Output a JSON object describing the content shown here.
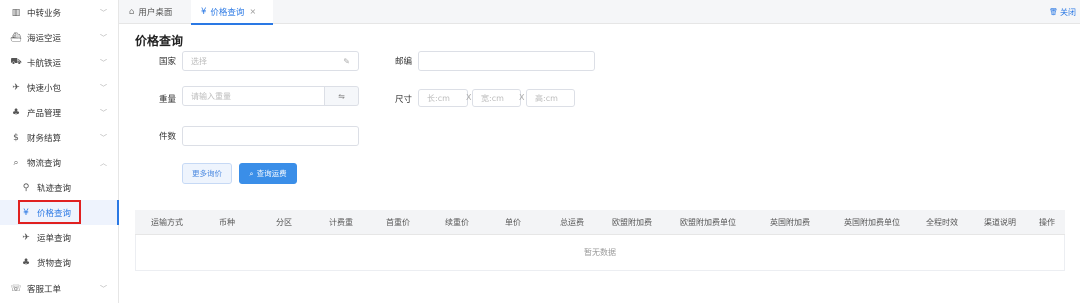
{
  "sidebar": {
    "items": [
      {
        "icon": "chart-icon",
        "glyph": "▥",
        "label": "中转业务",
        "chev": "﹀"
      },
      {
        "icon": "ship-icon",
        "glyph": "⛴",
        "label": "海运空运",
        "chev": "﹀"
      },
      {
        "icon": "truck-icon",
        "glyph": "⛟",
        "label": "卡航铁运",
        "chev": "﹀"
      },
      {
        "icon": "send-icon",
        "glyph": "✈",
        "label": "快速小包",
        "chev": "﹀"
      },
      {
        "icon": "product-icon",
        "glyph": "♣",
        "label": "产品管理",
        "chev": "﹀"
      },
      {
        "icon": "dollar-icon",
        "glyph": "$",
        "label": "财务结算",
        "chev": "﹀"
      },
      {
        "icon": "search-icon",
        "glyph": "⌕",
        "label": "物流查询",
        "chev": "︿"
      }
    ],
    "subitems": [
      {
        "icon": "location-icon",
        "glyph": "⚲",
        "label": "轨迹查询"
      },
      {
        "icon": "yen-icon",
        "glyph": "¥",
        "label": "价格查询"
      },
      {
        "icon": "send-icon",
        "glyph": "✈",
        "label": "运单查询"
      },
      {
        "icon": "goods-icon",
        "glyph": "♣",
        "label": "货物查询"
      }
    ],
    "last": {
      "icon": "service-icon",
      "glyph": "☏",
      "label": "客服工单",
      "chev": "﹀"
    }
  },
  "tabs": {
    "home": {
      "icon": "home-icon",
      "glyph": "⌂",
      "label": "用户桌面"
    },
    "active": {
      "icon": "yen-icon",
      "glyph": "¥",
      "label": "价格查询",
      "close": "×"
    },
    "close_all": {
      "icon": "trash-icon",
      "glyph": "🗑",
      "label": "关闭"
    }
  },
  "form": {
    "title": "价格查询",
    "country": {
      "label": "国家",
      "placeholder": "选择"
    },
    "postcode": {
      "label": "邮编",
      "value": ""
    },
    "weight": {
      "label": "重量",
      "placeholder": "请输入重量"
    },
    "size": {
      "label": "尺寸",
      "length": "长:cm",
      "width": "宽:cm",
      "height": "高:cm",
      "sep": "X"
    },
    "pieces": {
      "label": "件数",
      "value": ""
    },
    "more_button": "更多询价",
    "query_button": "查询运费"
  },
  "table": {
    "columns": [
      "运输方式",
      "币种",
      "分区",
      "计费重",
      "首重价",
      "续重价",
      "单价",
      "总运费",
      "欧盟附加费",
      "欧盟附加费单位",
      "英国附加费",
      "英国附加费单位",
      "全程时效",
      "渠道说明",
      "操作"
    ],
    "empty_text": "暂无数据"
  },
  "colors": {
    "accent": "#2a78e4",
    "highlight": "#e02020"
  }
}
